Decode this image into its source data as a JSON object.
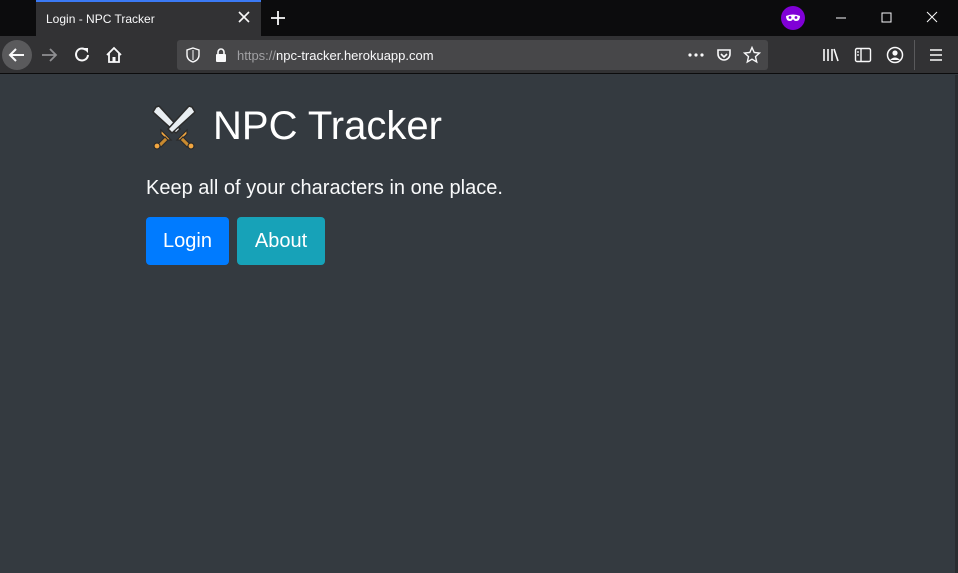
{
  "browser": {
    "tab": {
      "title": "Login - NPC Tracker"
    },
    "url": {
      "protocol": "https://",
      "host": "npc-tracker.herokuapp.com"
    },
    "icons": [
      "close-icon",
      "plus-icon",
      "private-mask-icon",
      "minimize-icon",
      "maximize-icon",
      "window-close-icon",
      "back-arrow-icon",
      "forward-arrow-icon",
      "reload-icon",
      "home-icon",
      "shield-icon",
      "lock-icon",
      "more-icon",
      "pocket-icon",
      "star-icon",
      "library-icon",
      "sidebar-icon",
      "account-icon",
      "menu-icon"
    ],
    "colors": {
      "private": "#8000d7",
      "tab_accent": "#3b7af5"
    }
  },
  "page": {
    "title": "NPC Tracker",
    "tagline": "Keep all of your characters in one place.",
    "buttons": {
      "login": "Login",
      "about": "About"
    },
    "logo": "crossed-swords-icon",
    "colors": {
      "background": "#343a40",
      "login": "#007bff",
      "about": "#17a2b8"
    }
  }
}
